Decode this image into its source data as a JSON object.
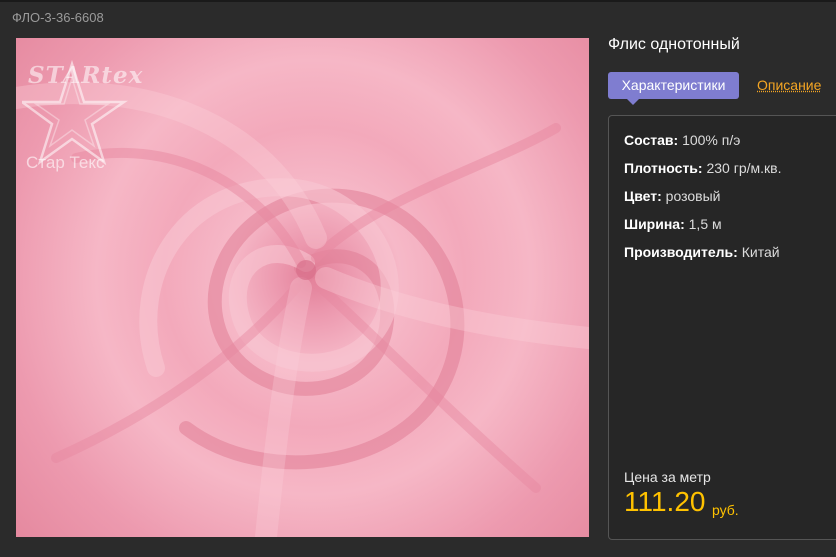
{
  "product": {
    "sku": "ФЛО-3-36-6608",
    "title": "Флис однотонный"
  },
  "image": {
    "logo_title": "STARtex",
    "logo_subtitle": "Стар Текс",
    "fabric_color": "#f3a9bb"
  },
  "tabs": {
    "characteristics": "Характеристики",
    "description": "Описание"
  },
  "specs": [
    {
      "label": "Состав:",
      "value": " 100% п/э"
    },
    {
      "label": "Плотность:",
      "value": " 230 гр/м.кв."
    },
    {
      "label": "Цвет:",
      "value": " розовый"
    },
    {
      "label": "Ширина:",
      "value": " 1,5 м"
    },
    {
      "label": "Производитель:",
      "value": " Китай"
    }
  ],
  "price": {
    "label": "Цена за метр",
    "value": "111.20",
    "currency": "руб."
  },
  "colors": {
    "tab_active": "#7f7dd0",
    "link": "#f5a623",
    "price": "#ffc200",
    "background": "#2b2b2b"
  }
}
